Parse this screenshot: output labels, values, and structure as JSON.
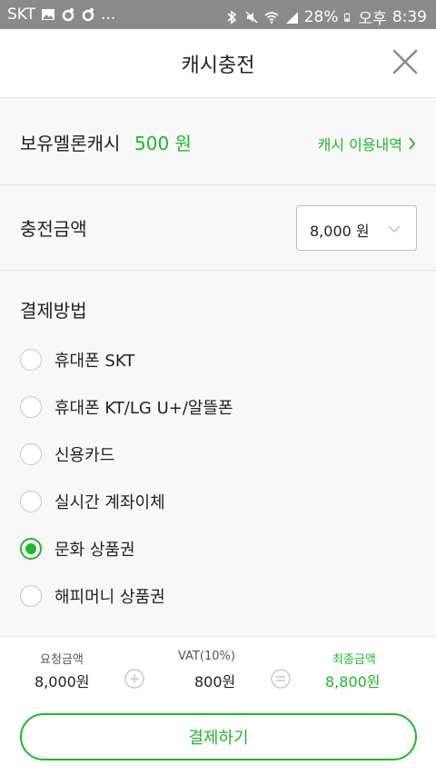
{
  "status_bar": {
    "carrier": "SKT",
    "ellipsis": "...",
    "battery": "28%",
    "ampm": "오후",
    "time": "8:39"
  },
  "header": {
    "title": "캐시충전"
  },
  "balance": {
    "label": "보유멜론캐시",
    "amount": "500 원",
    "history_link": "캐시 이용내역"
  },
  "charge": {
    "label": "충전금액",
    "selected_amount": "8,000 원"
  },
  "payment": {
    "heading": "결제방법",
    "options": [
      {
        "label": "휴대폰 SKT",
        "selected": false
      },
      {
        "label": "휴대폰 KT/LG U+/알뜰폰",
        "selected": false
      },
      {
        "label": "신용카드",
        "selected": false
      },
      {
        "label": "실시간 계좌이체",
        "selected": false
      },
      {
        "label": "문화 상품권",
        "selected": true
      },
      {
        "label": "해피머니 상품권",
        "selected": false
      }
    ]
  },
  "summary": {
    "request_label": "요청금액",
    "request_value": "8,000원",
    "vat_label": "VAT(10%)",
    "vat_value": "800원",
    "final_label": "최종금액",
    "final_value": "8,800원"
  },
  "pay_button": "결제하기",
  "colors": {
    "accent": "#1fb82b",
    "status_bar": "#8a8a8a",
    "section_bg": "#f8f8f8"
  }
}
